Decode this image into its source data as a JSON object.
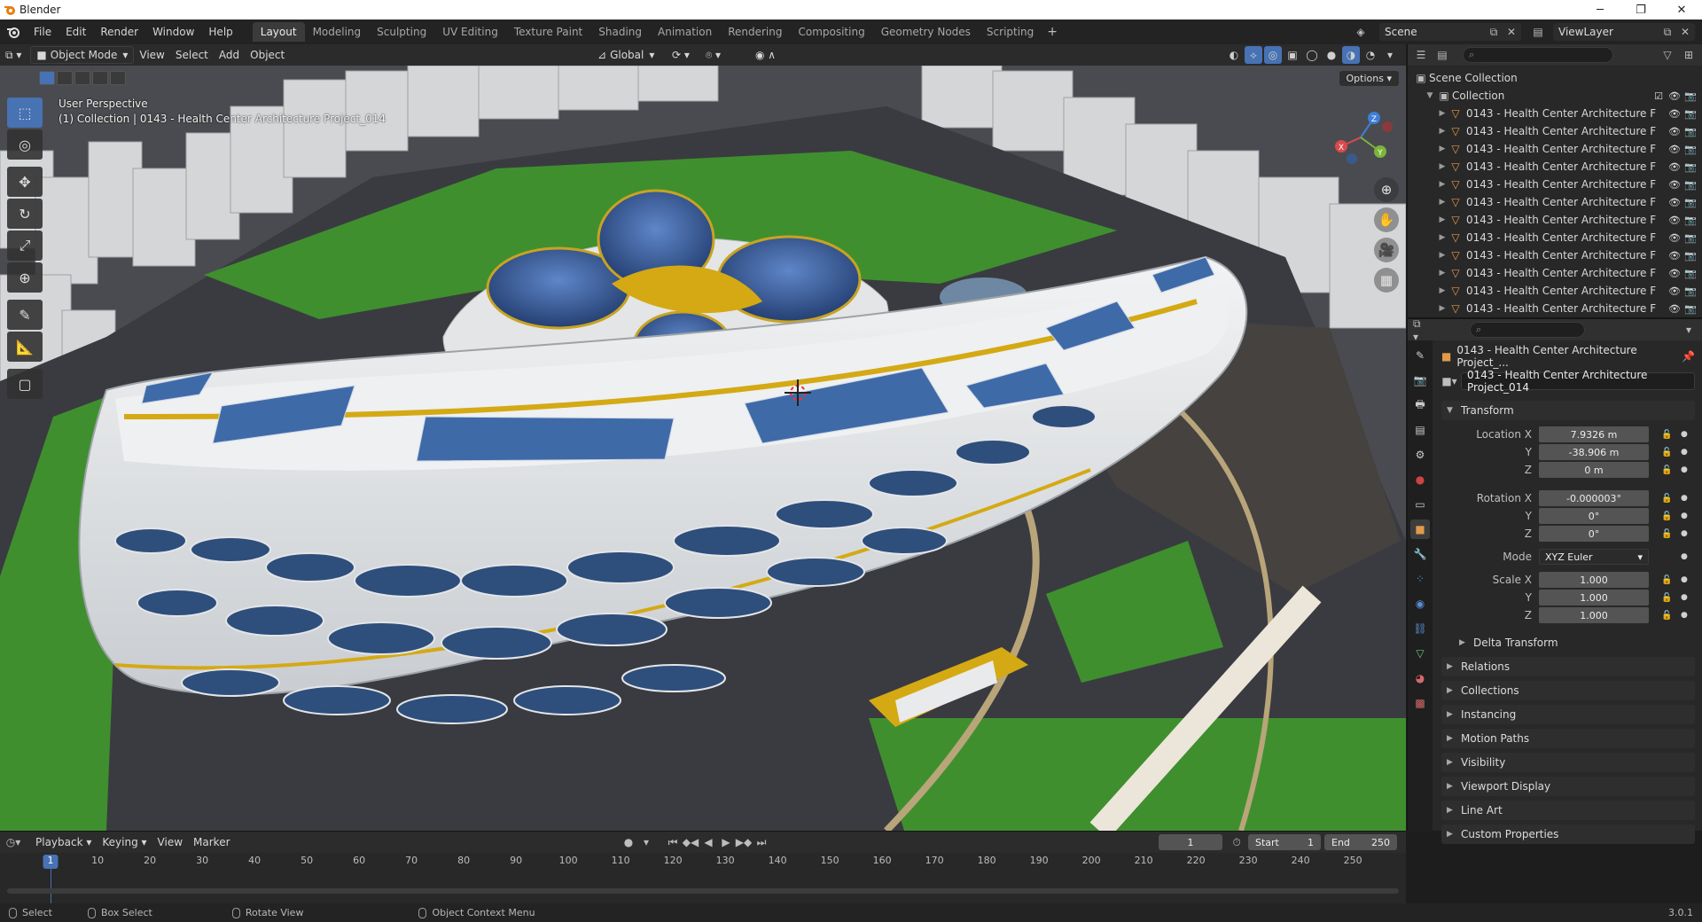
{
  "window": {
    "title": "Blender"
  },
  "menu": [
    "File",
    "Edit",
    "Render",
    "Window",
    "Help"
  ],
  "workspaces": [
    "Layout",
    "Modeling",
    "Sculpting",
    "UV Editing",
    "Texture Paint",
    "Shading",
    "Animation",
    "Rendering",
    "Compositing",
    "Geometry Nodes",
    "Scripting"
  ],
  "active_workspace": "Layout",
  "scene": "Scene",
  "view_layer": "ViewLayer",
  "viewport": {
    "mode": "Object Mode",
    "menus": [
      "View",
      "Select",
      "Add",
      "Object"
    ],
    "orientation": "Global",
    "options_label": "Options",
    "perspective_label": "User Perspective",
    "collection_label": "(1) Collection | 0143 - Health Center Architecture Project_014",
    "gizmo_axes": {
      "x": "X",
      "y": "Y",
      "z": "Z"
    }
  },
  "outliner": {
    "root": "Scene Collection",
    "collection": "Collection",
    "items": [
      "0143 - Health Center Architecture F",
      "0143 - Health Center Architecture F",
      "0143 - Health Center Architecture F",
      "0143 - Health Center Architecture F",
      "0143 - Health Center Architecture F",
      "0143 - Health Center Architecture F",
      "0143 - Health Center Architecture F",
      "0143 - Health Center Architecture F",
      "0143 - Health Center Architecture F",
      "0143 - Health Center Architecture F",
      "0143 - Health Center Architecture F",
      "0143 - Health Center Architecture F"
    ]
  },
  "properties": {
    "object_title": "0143 - Health Center Architecture Project_...",
    "object_name": "0143 - Health Center Architecture Project_014",
    "transform_label": "Transform",
    "location": {
      "label_x": "Location X",
      "label_y": "Y",
      "label_z": "Z",
      "x": "7.9326 m",
      "y": "-38.906 m",
      "z": "0 m"
    },
    "rotation": {
      "label_x": "Rotation X",
      "label_y": "Y",
      "label_z": "Z",
      "x": "-0.000003°",
      "y": "0°",
      "z": "0°"
    },
    "mode": {
      "label": "Mode",
      "value": "XYZ Euler"
    },
    "scale": {
      "label_x": "Scale X",
      "label_y": "Y",
      "label_z": "Z",
      "x": "1.000",
      "y": "1.000",
      "z": "1.000"
    },
    "delta_transform": "Delta Transform",
    "sections": [
      "Relations",
      "Collections",
      "Instancing",
      "Motion Paths",
      "Visibility",
      "Viewport Display",
      "Line Art",
      "Custom Properties"
    ]
  },
  "timeline": {
    "menus": [
      "Playback",
      "Keying",
      "View",
      "Marker"
    ],
    "current_frame": "1",
    "start_label": "Start",
    "start": "1",
    "end_label": "End",
    "end": "250",
    "ruler": [
      "10",
      "20",
      "30",
      "40",
      "50",
      "60",
      "70",
      "80",
      "90",
      "100",
      "110",
      "120",
      "130",
      "140",
      "150",
      "160",
      "170",
      "180",
      "190",
      "200",
      "210",
      "220",
      "230",
      "240",
      "250"
    ],
    "playhead": "1"
  },
  "statusbar": {
    "select": "Select",
    "box_select": "Box Select",
    "rotate_view": "Rotate View",
    "context_menu": "Object Context Menu",
    "version": "3.0.1"
  },
  "colors": {
    "accent": "#4772b3",
    "building_white": "#e6e8ea",
    "stripe_yellow": "#d4a914",
    "solar_blue": "#3f6aa8",
    "grass": "#3f8f2f",
    "asphalt": "#3e3e44",
    "mesh_orange": "#e29a4a"
  }
}
